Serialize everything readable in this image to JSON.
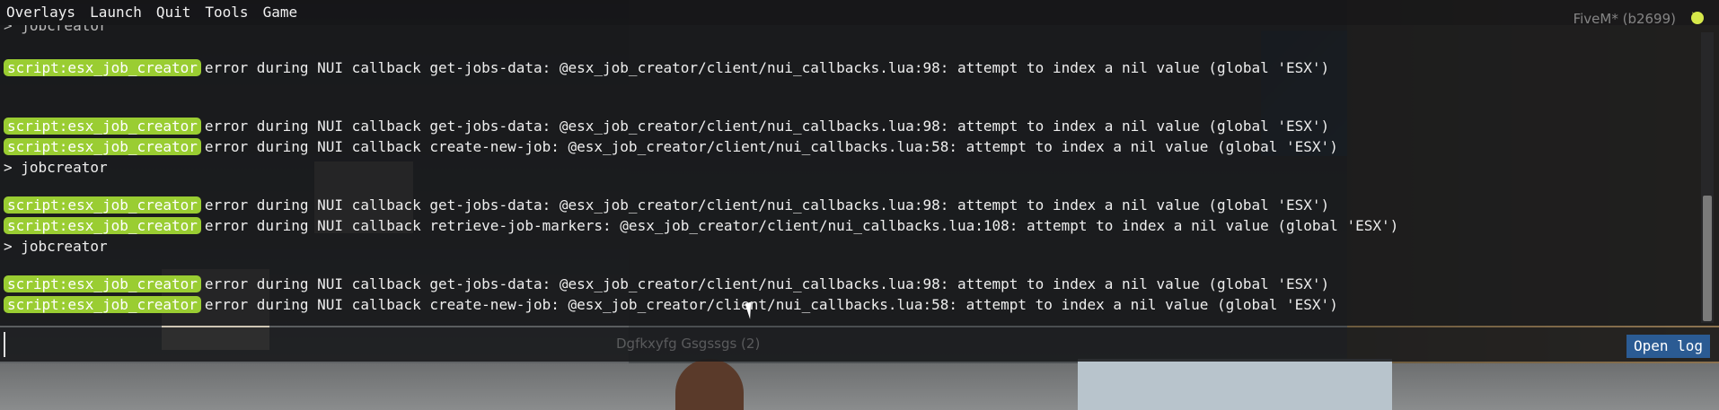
{
  "menubar": {
    "items": [
      {
        "label": "Overlays"
      },
      {
        "label": "Launch"
      },
      {
        "label": "Quit"
      },
      {
        "label": "Tools"
      },
      {
        "label": "Game"
      }
    ],
    "version": "FiveM* (b2699)",
    "icon": "fivem-logo-icon"
  },
  "console": {
    "partial_top_line": "> jobcreator",
    "lines": [
      {
        "tag": "script:esx_job_creator",
        "text": "error during NUI callback get-jobs-data: @esx_job_creator/client/nui_callbacks.lua:98: attempt to index a nil value (global 'ESX')"
      },
      {
        "tag": "script:esx_job_creator",
        "text": "error during NUI callback get-jobs-data: @esx_job_creator/client/nui_callbacks.lua:98: attempt to index a nil value (global 'ESX')"
      },
      {
        "tag": "script:esx_job_creator",
        "text": "error during NUI callback create-new-job: @esx_job_creator/client/nui_callbacks.lua:58: attempt to index a nil value (global 'ESX')"
      },
      {
        "tag": "",
        "text": "> jobcreator"
      },
      {
        "tag": "script:esx_job_creator",
        "text": "error during NUI callback get-jobs-data: @esx_job_creator/client/nui_callbacks.lua:98: attempt to index a nil value (global 'ESX')"
      },
      {
        "tag": "script:esx_job_creator",
        "text": "error during NUI callback retrieve-job-markers: @esx_job_creator/client/nui_callbacks.lua:108: attempt to index a nil value (global 'ESX')"
      },
      {
        "tag": "",
        "text": "> jobcreator"
      },
      {
        "tag": "script:esx_job_creator",
        "text": "error during NUI callback get-jobs-data: @esx_job_creator/client/nui_callbacks.lua:98: attempt to index a nil value (global 'ESX')"
      },
      {
        "tag": "script:esx_job_creator",
        "text": "error during NUI callback create-new-job: @esx_job_creator/client/nui_callbacks.lua:58: attempt to index a nil value (global 'ESX')"
      }
    ],
    "tag_color": "#9acd32"
  },
  "input": {
    "value": "",
    "ghost_text": "Dgfkxyfg Gsgssgs (2)"
  },
  "open_log_label": "Open log"
}
